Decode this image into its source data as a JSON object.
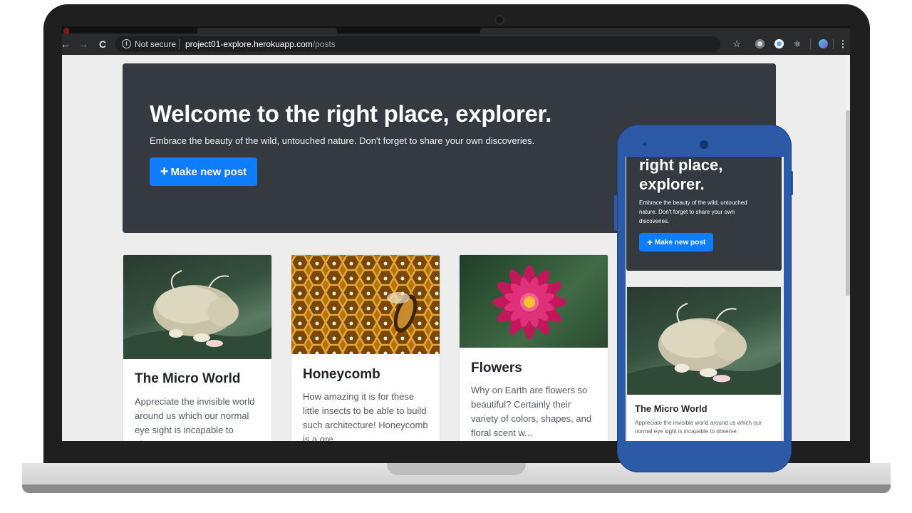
{
  "browser": {
    "security_label": "Not secure",
    "url_host": "project01-explore.herokuapp.com",
    "url_path": "/posts",
    "info_glyph": "i",
    "back_glyph": "←",
    "forward_glyph": "→",
    "reload_glyph": "C",
    "star_glyph": "☆",
    "menu_glyph": "⋮"
  },
  "hero": {
    "title": "Welcome to the right place, explorer.",
    "subtitle": "Embrace the beauty of the wild, untouched nature. Don't forget to share your own discoveries.",
    "button_icon": "+",
    "button_label": "Make new post"
  },
  "posts": [
    {
      "title": "The Micro World",
      "excerpt": "Appreciate the invisible world around us which our normal eye sight is incapable to observe."
    },
    {
      "title": "Honeycomb",
      "excerpt": "How amazing it is for these little insects to be able to build such architecture! Honeycomb is a gre..."
    },
    {
      "title": "Flowers",
      "excerpt": "Why on Earth are flowers so beautiful? Certainly their variety of colors, shapes, and floral scent w..."
    }
  ],
  "mobile": {
    "hero_title": "right place, explorer.",
    "hero_subtitle": "Embrace the beauty of the wild, untouched nature. Don't forget to share your own discoveries.",
    "button_icon": "+",
    "button_label": "Make new post",
    "card_title": "The Micro World",
    "card_text": "Appreciate the invisible world around us which our normal eye sight is incapable to observe."
  },
  "colors": {
    "primary": "#0d7dfe",
    "hero_bg": "#343a40",
    "page_bg": "#ededed",
    "phone_body": "#2d5aa6"
  }
}
